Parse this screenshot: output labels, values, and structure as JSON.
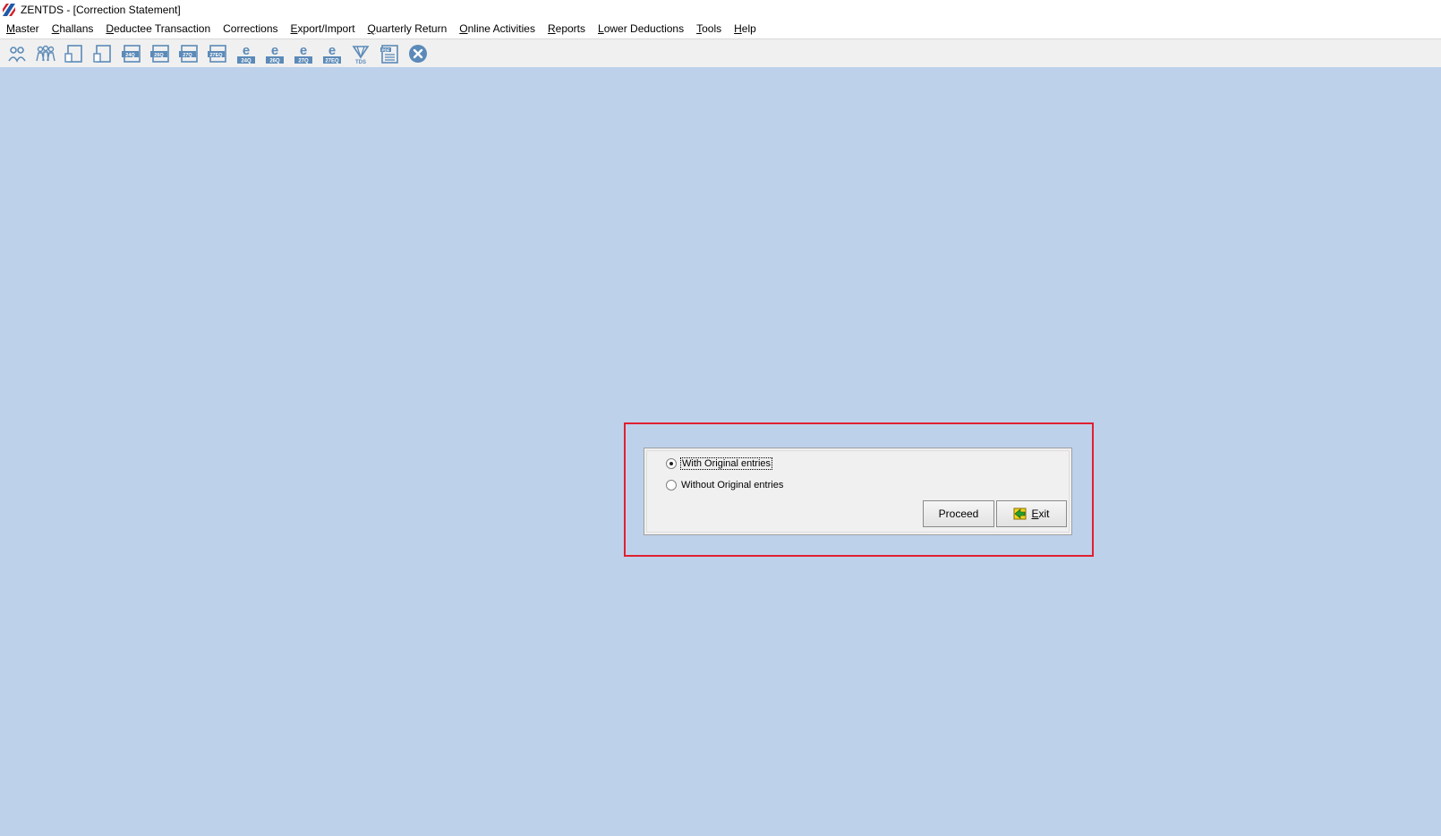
{
  "window": {
    "title": "ZENTDS - [Correction Statement]"
  },
  "menubar": {
    "items": [
      {
        "first": "M",
        "rest": "aster"
      },
      {
        "first": "C",
        "rest": "hallans"
      },
      {
        "first": "D",
        "rest": "eductee Transaction"
      },
      {
        "first": "",
        "rest": "Corrections"
      },
      {
        "first": "E",
        "rest": "xport/Import"
      },
      {
        "first": "Q",
        "rest": "uarterly Return"
      },
      {
        "first": "O",
        "rest": "nline Activities"
      },
      {
        "first": "R",
        "rest": "eports"
      },
      {
        "first": "L",
        "rest": "ower Deductions"
      },
      {
        "first": "T",
        "rest": "ools"
      },
      {
        "first": "H",
        "rest": "elp"
      }
    ]
  },
  "toolbar": {
    "icons": [
      {
        "name": "deductor-icon",
        "text": ""
      },
      {
        "name": "deductees-icon",
        "text": ""
      },
      {
        "name": "form-icon",
        "text": ""
      },
      {
        "name": "form-alt-icon",
        "text": ""
      },
      {
        "name": "form-24q-icon",
        "text": "24Q"
      },
      {
        "name": "form-26q-icon",
        "text": "26Q"
      },
      {
        "name": "form-27q-icon",
        "text": "27Q"
      },
      {
        "name": "form-27eq-icon",
        "text": "27EQ"
      },
      {
        "name": "e-24q-icon",
        "text": "24Q"
      },
      {
        "name": "e-26q-icon",
        "text": "26Q"
      },
      {
        "name": "e-27q-icon",
        "text": "27Q"
      },
      {
        "name": "e-27eq-icon",
        "text": "27EQ"
      },
      {
        "name": "tds-icon",
        "text": "TDS"
      },
      {
        "name": "pdf-icon",
        "text": "PDF"
      },
      {
        "name": "close-icon",
        "text": ""
      }
    ]
  },
  "dialog": {
    "option_with": "With Original entries",
    "option_without": "Without Original entries",
    "selected": "with",
    "proceed_label": "Proceed",
    "exit_first": "E",
    "exit_rest": "xit"
  },
  "colors": {
    "workspace": "#bdd1eb",
    "icon": "#5b8ab8",
    "highlight": "#e02030"
  }
}
